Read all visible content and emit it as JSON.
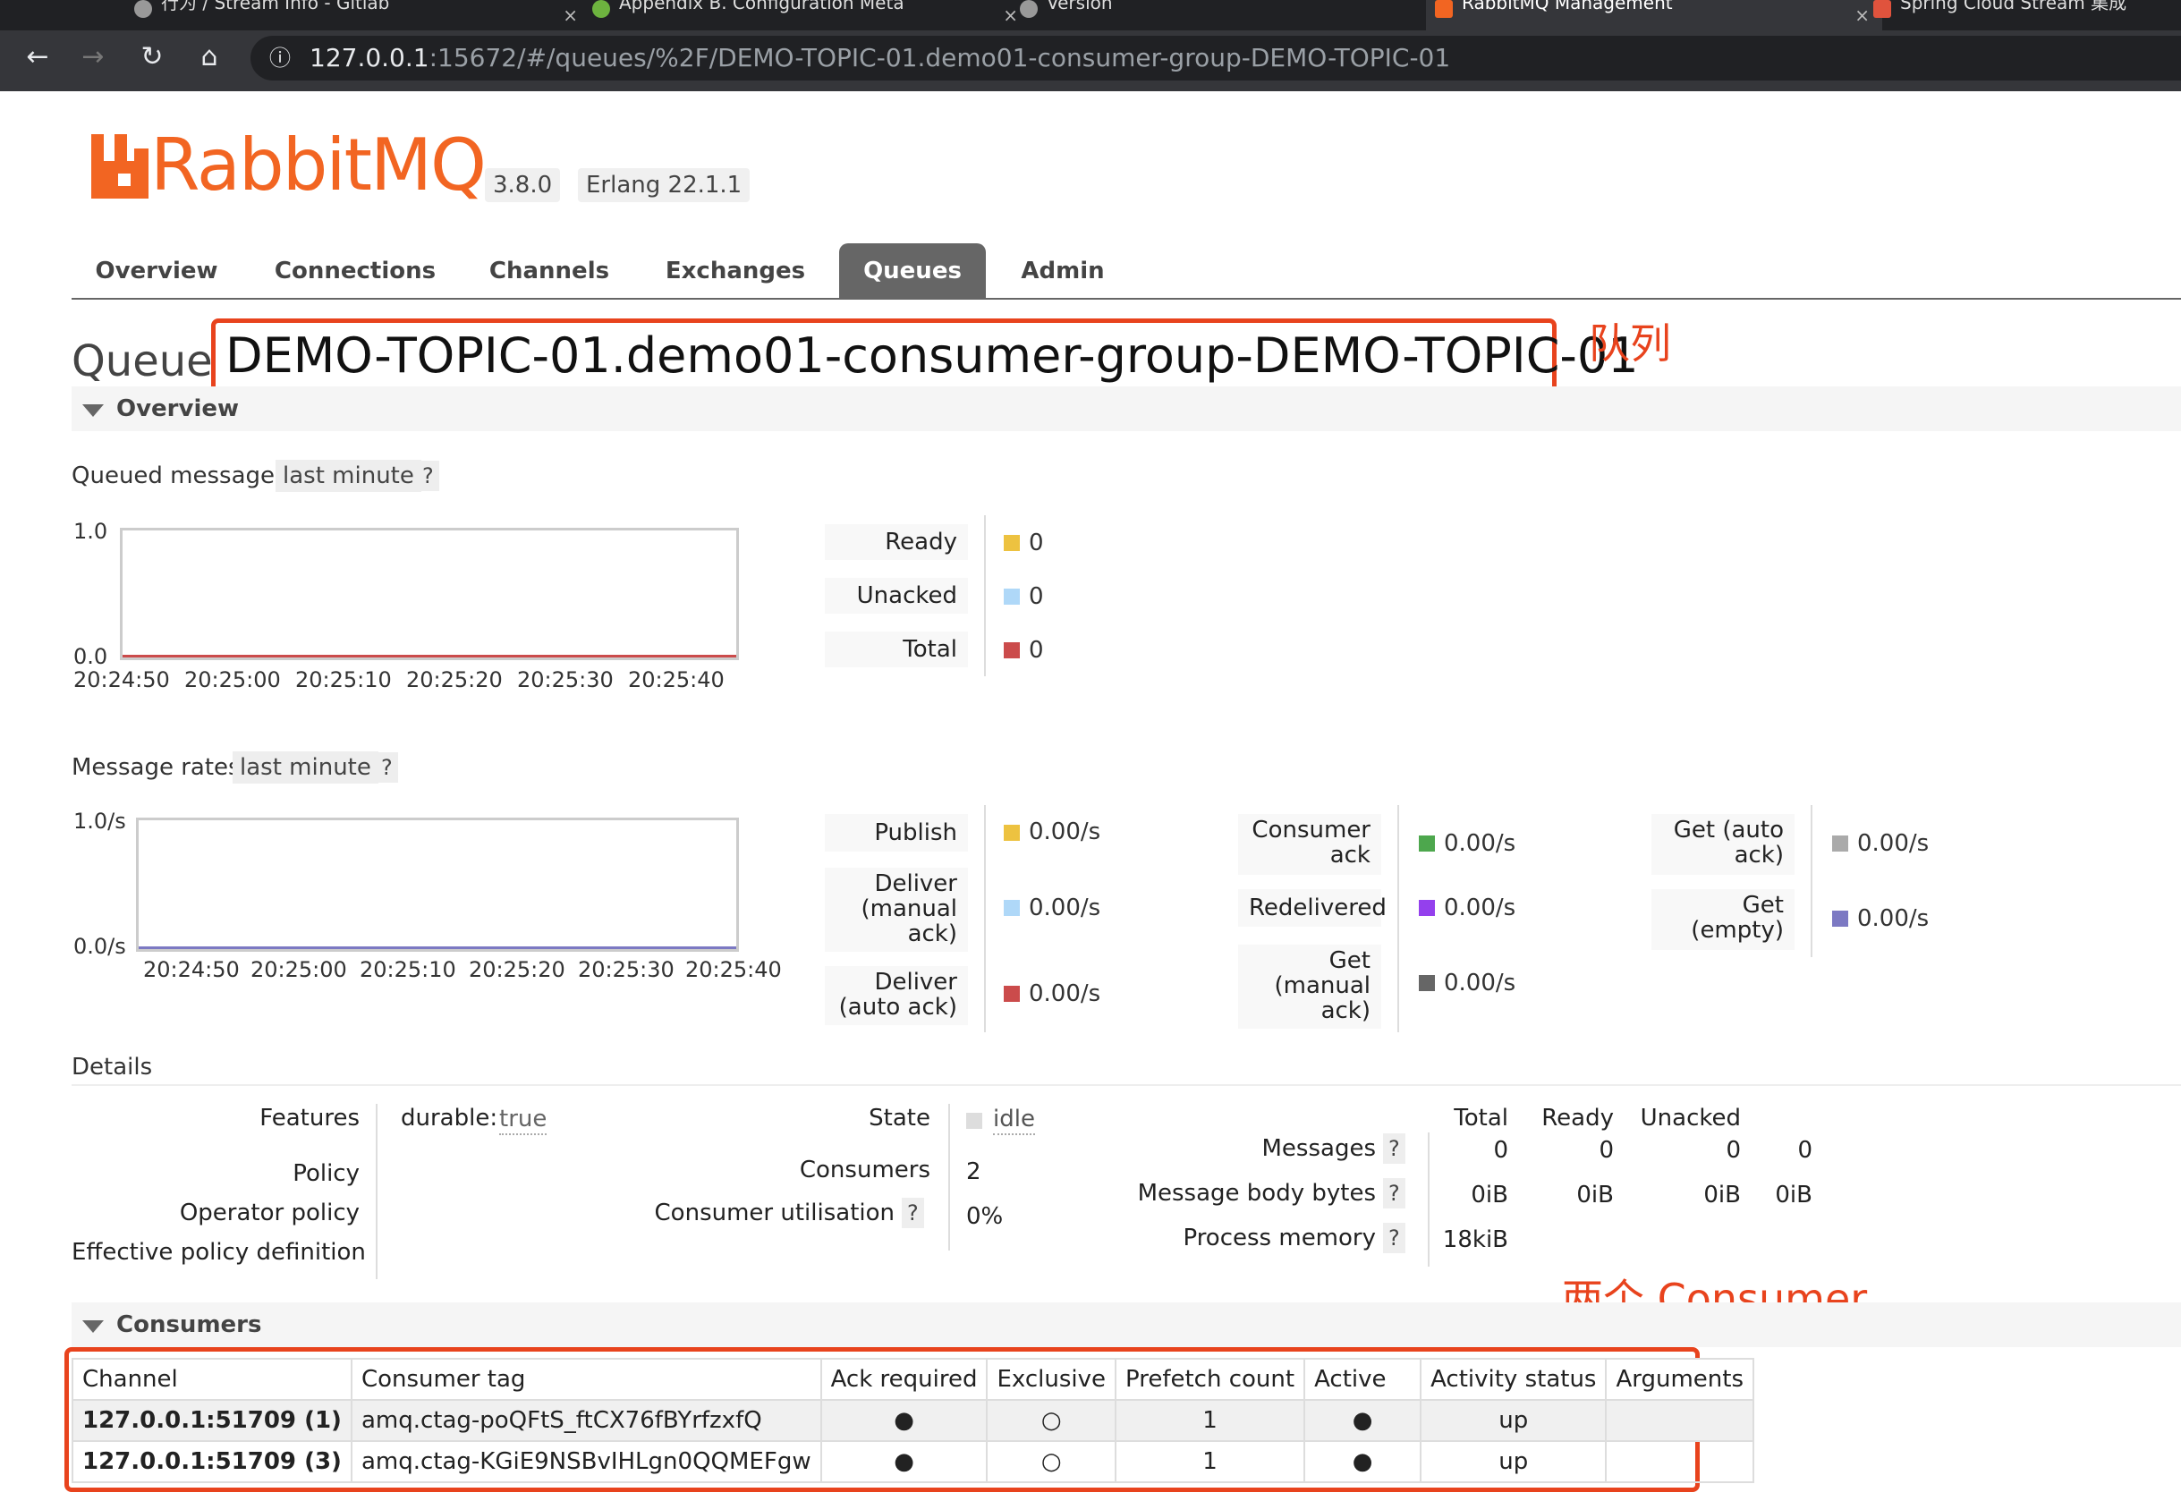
{
  "browser": {
    "tabs": [
      {
        "label": "行为 / Stream Info - Gitlab",
        "active": false
      },
      {
        "label": "Appendix B. Configuration Meta",
        "active": false
      },
      {
        "label": "Version",
        "active": false
      },
      {
        "label": "RabbitMQ Management",
        "active": true
      },
      {
        "label": "Spring Cloud Stream 集成",
        "active": false
      }
    ],
    "url_host": "127.0.0.1",
    "url_rest": ":15672/#/queues/%2F/DEMO-TOPIC-01.demo01-consumer-group-DEMO-TOPIC-01"
  },
  "header": {
    "logo_text": "RabbitMQ",
    "version": "3.8.0",
    "erlang": "Erlang 22.1.1"
  },
  "nav": {
    "tabs": [
      "Overview",
      "Connections",
      "Channels",
      "Exchanges",
      "Queues",
      "Admin"
    ],
    "selected": "Queues"
  },
  "page": {
    "title_prefix": "Queue",
    "queue_name": "DEMO-TOPIC-01.demo01-consumer-group-DEMO-TOPIC-01",
    "annotation_queue": "队列",
    "annotation_consumers": "两个 Consumer"
  },
  "overview": {
    "section_title": "Overview",
    "queued_label": "Queued messages",
    "queued_range": "last minute",
    "help": "?",
    "queued_chart": {
      "ymax": "1.0",
      "ymin": "0.0",
      "xticks": [
        "20:24:50",
        "20:25:00",
        "20:25:10",
        "20:25:20",
        "20:25:30",
        "20:25:40"
      ]
    },
    "queued_legend": [
      {
        "label": "Ready",
        "value": "0",
        "color": "#edc240"
      },
      {
        "label": "Unacked",
        "value": "0",
        "color": "#afd8f8"
      },
      {
        "label": "Total",
        "value": "0",
        "color": "#cb4b4b"
      }
    ],
    "rates_label": "Message rates",
    "rates_range": "last minute",
    "rates_chart": {
      "ymax": "1.0/s",
      "ymin": "0.0/s",
      "xticks": [
        "20:24:50",
        "20:25:00",
        "20:25:10",
        "20:25:20",
        "20:25:30",
        "20:25:40"
      ]
    },
    "rates_col1": [
      {
        "label": "Publish",
        "value": "0.00/s",
        "color": "#edc240"
      },
      {
        "label": "Deliver (manual ack)",
        "value": "0.00/s",
        "color": "#afd8f8"
      },
      {
        "label": "Deliver (auto ack)",
        "value": "0.00/s",
        "color": "#cb4b4b"
      }
    ],
    "rates_col2": [
      {
        "label": "Consumer ack",
        "value": "0.00/s",
        "color": "#4da74d"
      },
      {
        "label": "Redelivered",
        "value": "0.00/s",
        "color": "#9440ed"
      },
      {
        "label": "Get (manual ack)",
        "value": "0.00/s",
        "color": "#666666"
      }
    ],
    "rates_col3": [
      {
        "label": "Get (auto ack)",
        "value": "0.00/s",
        "color": "#aaaaaa"
      },
      {
        "label": "Get (empty)",
        "value": "0.00/s",
        "color": "#7c79c3"
      }
    ]
  },
  "details": {
    "title": "Details",
    "features_label": "Features",
    "durable_key": "durable:",
    "durable_val": "true",
    "policy_label": "Policy",
    "operator_policy_label": "Operator policy",
    "effective_policy_label": "Effective policy definition",
    "state_label": "State",
    "state_value": "idle",
    "consumers_label": "Consumers",
    "consumers_value": "2",
    "utilisation_label": "Consumer utilisation",
    "utilisation_value": "0%",
    "headers": [
      "Total",
      "Ready",
      "Unacked"
    ],
    "messages_label": "Messages",
    "messages_values": [
      "0",
      "0",
      "0",
      "0"
    ],
    "body_bytes_label": "Message body bytes",
    "body_bytes_values": [
      "0iB",
      "0iB",
      "0iB",
      "0iB"
    ],
    "process_memory_label": "Process memory",
    "process_memory_value": "18kiB"
  },
  "consumers": {
    "section_title": "Consumers",
    "columns": [
      "Channel",
      "Consumer tag",
      "Ack required",
      "Exclusive",
      "Prefetch count",
      "Active",
      "Activity status",
      "Arguments"
    ],
    "rows": [
      {
        "channel": "127.0.0.1:51709 (1)",
        "tag": "amq.ctag-poQFtS_ftCX76fBYrfzxfQ",
        "ack": "●",
        "exclusive": "○",
        "prefetch": "1",
        "active": "●",
        "status": "up",
        "arguments": ""
      },
      {
        "channel": "127.0.0.1:51709 (3)",
        "tag": "amq.ctag-KGiE9NSBvIHLgn0QQMEFgw",
        "ack": "●",
        "exclusive": "○",
        "prefetch": "1",
        "active": "●",
        "status": "up",
        "arguments": ""
      }
    ]
  }
}
